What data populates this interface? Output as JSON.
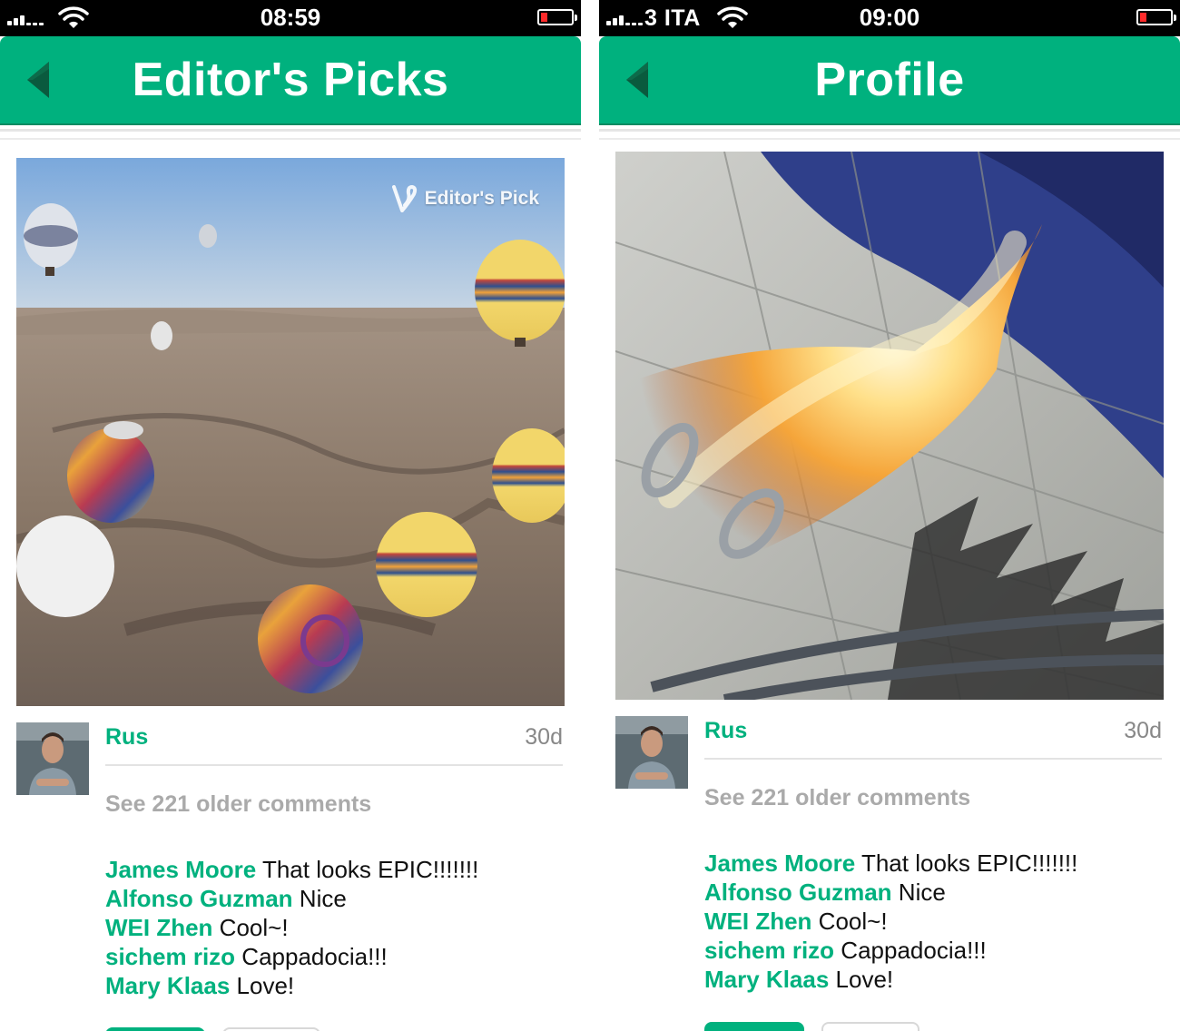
{
  "left": {
    "status": {
      "carrier": "",
      "time": "08:59"
    },
    "header": {
      "title": "Editor's Picks"
    },
    "video": {
      "badge": "Editor's Pick"
    },
    "post": {
      "username": "Rus",
      "age": "30d",
      "older_comments": "See 221 older comments",
      "comments": [
        {
          "user": "James Moore",
          "text": "That looks EPIC!!!!!!!"
        },
        {
          "user": "Alfonso Guzman",
          "text": "Nice"
        },
        {
          "user": "WEI Zhen",
          "text": "Cool~!"
        },
        {
          "user": "sichem rizo",
          "text": "Cappadocia!!!"
        },
        {
          "user": "Mary Klaas",
          "text": "Love!"
        }
      ]
    }
  },
  "right": {
    "status": {
      "carrier": "3 ITA",
      "time": "09:00"
    },
    "header": {
      "title": "Profile"
    },
    "post": {
      "username": "Rus",
      "age": "30d",
      "older_comments": "See 221 older comments",
      "comments": [
        {
          "user": "James Moore",
          "text": "That looks EPIC!!!!!!!"
        },
        {
          "user": "Alfonso Guzman",
          "text": "Nice"
        },
        {
          "user": "WEI Zhen",
          "text": "Cool~!"
        },
        {
          "user": "sichem rizo",
          "text": "Cappadocia!!!"
        },
        {
          "user": "Mary Klaas",
          "text": "Love!"
        }
      ]
    }
  },
  "colors": {
    "accent": "#00b17e",
    "battery_low": "#ff2a2a"
  },
  "icons": [
    "signal-icon",
    "wifi-icon",
    "battery-icon",
    "back-arrow-icon",
    "vine-logo-icon"
  ]
}
